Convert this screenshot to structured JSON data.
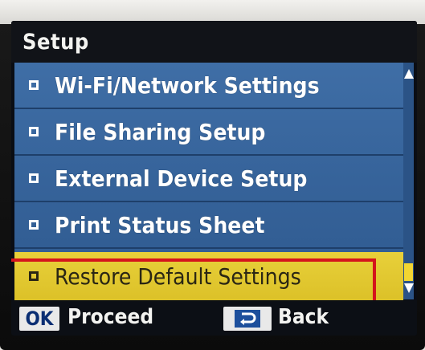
{
  "title": "Setup",
  "menu": {
    "items": [
      {
        "label": "Wi-Fi/Network Settings",
        "selected": false
      },
      {
        "label": "File Sharing Setup",
        "selected": false
      },
      {
        "label": "External Device Setup",
        "selected": false
      },
      {
        "label": "Print Status Sheet",
        "selected": false
      },
      {
        "label": "Restore Default Settings",
        "selected": true
      }
    ]
  },
  "footer": {
    "ok_key": "OK",
    "proceed_label": "Proceed",
    "back_label": "Back"
  },
  "colors": {
    "list_bg": "#3f6ea6",
    "selected_bg": "#e8d03a",
    "highlight_outline": "#d4141c"
  },
  "icons": {
    "back_key": "return-arrow-icon",
    "scroll_up": "triangle-up-icon",
    "scroll_down": "triangle-down-icon",
    "bullet": "square-bullet-icon"
  }
}
